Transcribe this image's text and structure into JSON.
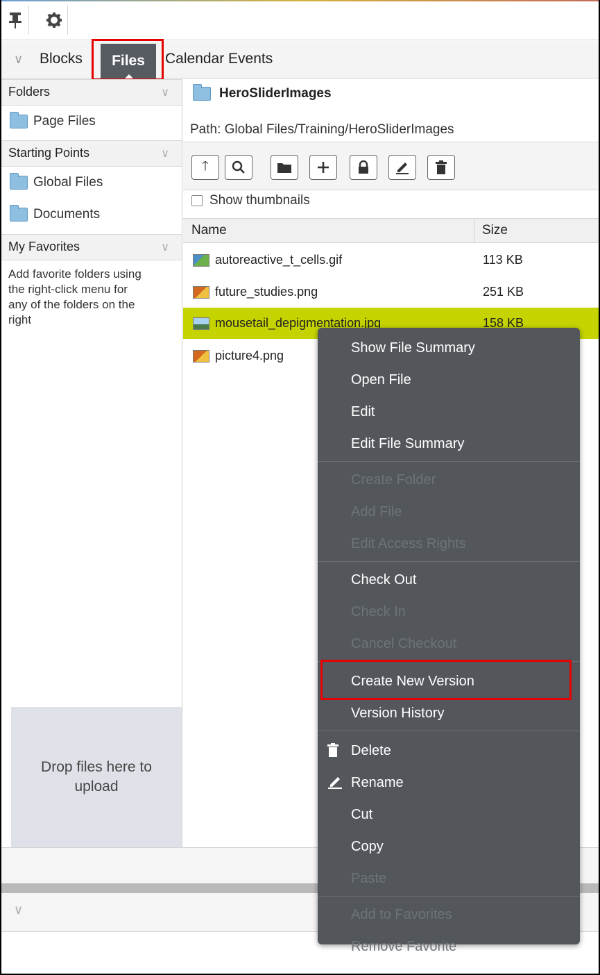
{
  "toolbar": {
    "pin_icon": "pin-icon",
    "gear_icon": "gear-icon"
  },
  "tabs": [
    "Blocks",
    "Files",
    "Calendar Events"
  ],
  "left": {
    "folders_header": "Folders",
    "page_files": "Page Files",
    "starting_header": "Starting Points",
    "global_files": "Global Files",
    "documents": "Documents",
    "favorites_header": "My Favorites",
    "favorites_help": "Add favorite folders using the right-click menu for any of the folders on the right",
    "drop_text": "Drop files here to upload"
  },
  "right": {
    "current_folder": "HeroSliderImages",
    "path": "Path: Global Files/Training/HeroSliderImages",
    "show_thumbnails": "Show thumbnails",
    "col_name": "Name",
    "col_size": "Size",
    "files": [
      {
        "name": "autoreactive_t_cells.gif",
        "size": "113 KB"
      },
      {
        "name": "future_studies.png",
        "size": "251 KB"
      },
      {
        "name": "mousetail_depigmentation.jpg",
        "size": "158 KB"
      },
      {
        "name": "picture4.png",
        "size": ""
      }
    ]
  },
  "menu": {
    "show_summary": "Show File Summary",
    "open_file": "Open File",
    "edit": "Edit",
    "edit_summary": "Edit File Summary",
    "create_folder": "Create Folder",
    "add_file": "Add File",
    "edit_access": "Edit Access Rights",
    "check_out": "Check Out",
    "check_in": "Check In",
    "cancel_checkout": "Cancel Checkout",
    "create_version": "Create New Version",
    "version_history": "Version History",
    "delete": "Delete",
    "rename": "Rename",
    "cut": "Cut",
    "copy": "Copy",
    "paste": "Paste",
    "add_fav": "Add to Favorites",
    "remove_fav": "Remove Favorite"
  },
  "colors": {
    "selected_row": "#c5d400",
    "menu_bg": "#53575c",
    "highlight": "#e60000"
  }
}
